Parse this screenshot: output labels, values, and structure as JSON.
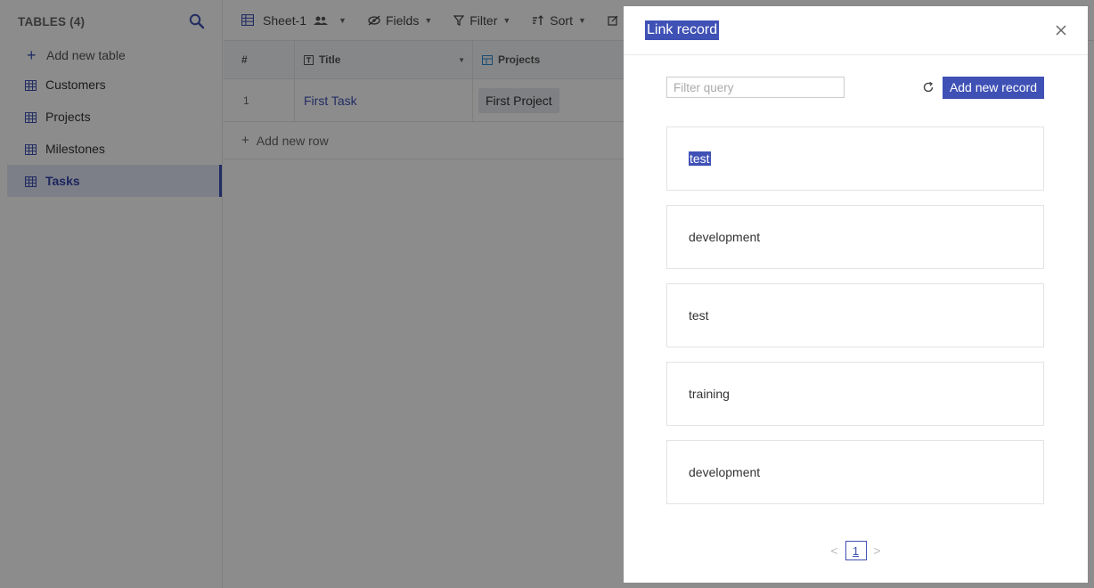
{
  "sidebar": {
    "title": "TABLES (4)",
    "add_table_label": "Add new table",
    "items": [
      {
        "label": "Customers"
      },
      {
        "label": "Projects"
      },
      {
        "label": "Milestones"
      },
      {
        "label": "Tasks"
      }
    ],
    "active_index": 3
  },
  "toolbar": {
    "sheet_label": "Sheet-1",
    "fields_label": "Fields",
    "filter_label": "Filter",
    "sort_label": "Sort"
  },
  "grid": {
    "columns": [
      {
        "label": "#"
      },
      {
        "label": "Title"
      },
      {
        "label": "Projects"
      }
    ],
    "rows": [
      {
        "num": "1",
        "title": "First Task",
        "project": "First Project"
      }
    ],
    "add_row_label": "Add new row"
  },
  "drawer": {
    "title": "Link record",
    "filter_placeholder": "Filter query",
    "add_record_label": "Add new record",
    "records": [
      {
        "label": "test",
        "selected": true
      },
      {
        "label": "development"
      },
      {
        "label": "test"
      },
      {
        "label": "training"
      },
      {
        "label": "development"
      }
    ],
    "pagination": {
      "current_page": "1",
      "prev": "<",
      "next": ">"
    }
  },
  "colors": {
    "accent": "#3f51b5",
    "active_bg": "#e4e7f7",
    "overlay": "rgba(0,0,0,0.45)"
  }
}
